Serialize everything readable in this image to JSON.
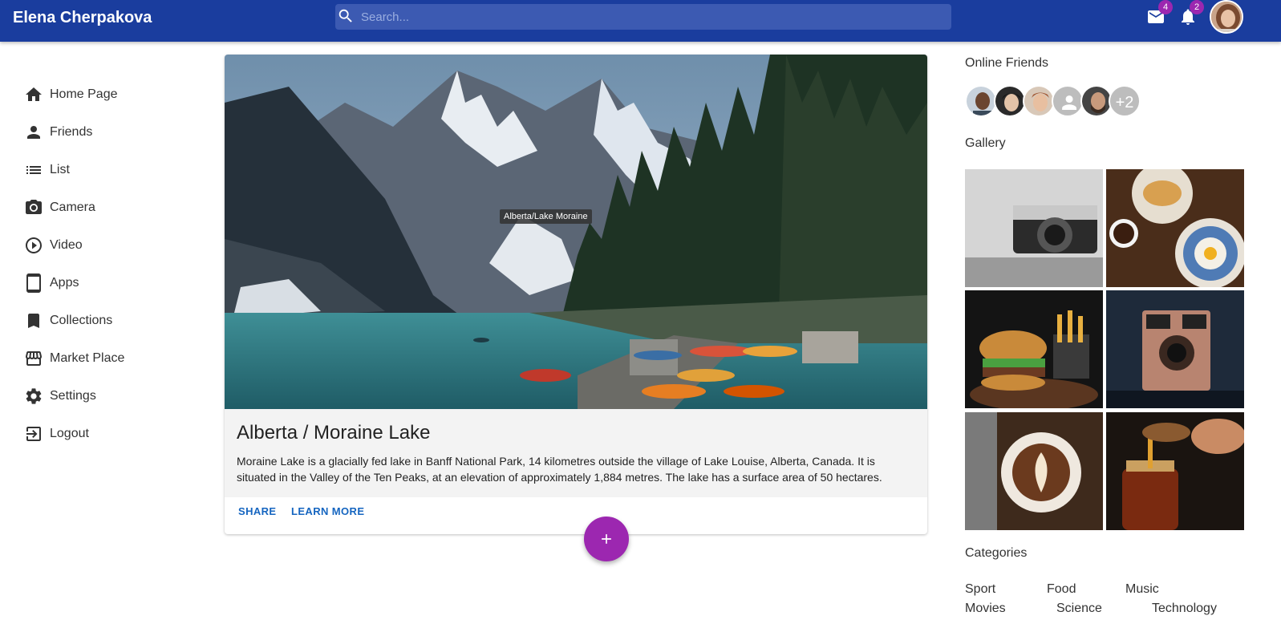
{
  "header": {
    "user_name": "Elena Cherpakova",
    "search_placeholder": "Search...",
    "mail_count": "4",
    "notification_count": "2"
  },
  "nav": {
    "items": [
      {
        "label": "Home Page",
        "icon": "home-icon"
      },
      {
        "label": "Friends",
        "icon": "person-icon"
      },
      {
        "label": "List",
        "icon": "list-icon"
      },
      {
        "label": "Camera",
        "icon": "camera-icon"
      },
      {
        "label": "Video",
        "icon": "play-circle-icon"
      },
      {
        "label": "Apps",
        "icon": "tablet-icon"
      },
      {
        "label": "Collections",
        "icon": "bookmark-icon"
      },
      {
        "label": "Market Place",
        "icon": "store-icon"
      },
      {
        "label": "Settings",
        "icon": "gear-icon"
      },
      {
        "label": "Logout",
        "icon": "logout-icon"
      }
    ]
  },
  "post": {
    "image_tooltip": "Alberta/Lake Moraine",
    "title": "Alberta / Moraine Lake",
    "text": "Moraine Lake is a glacially fed lake in Banff National Park, 14 kilometres outside the village of Lake Louise, Alberta, Canada. It is situated in the Valley of the Ten Peaks, at an elevation of approximately 1,884 metres. The lake has a surface area of 50 hectares.",
    "share_label": "SHARE",
    "learn_more_label": "LEARN MORE"
  },
  "sidebar": {
    "online_friends_title": "Online Friends",
    "more_friends": "+2",
    "gallery_title": "Gallery",
    "categories_title": "Categories",
    "categories": [
      "Sport",
      "Food",
      "Music",
      "Movies",
      "Science",
      "Technology"
    ]
  },
  "colors": {
    "appbar": "#1a3d9e",
    "accent": "#9c27b0",
    "link": "#1565c0"
  }
}
